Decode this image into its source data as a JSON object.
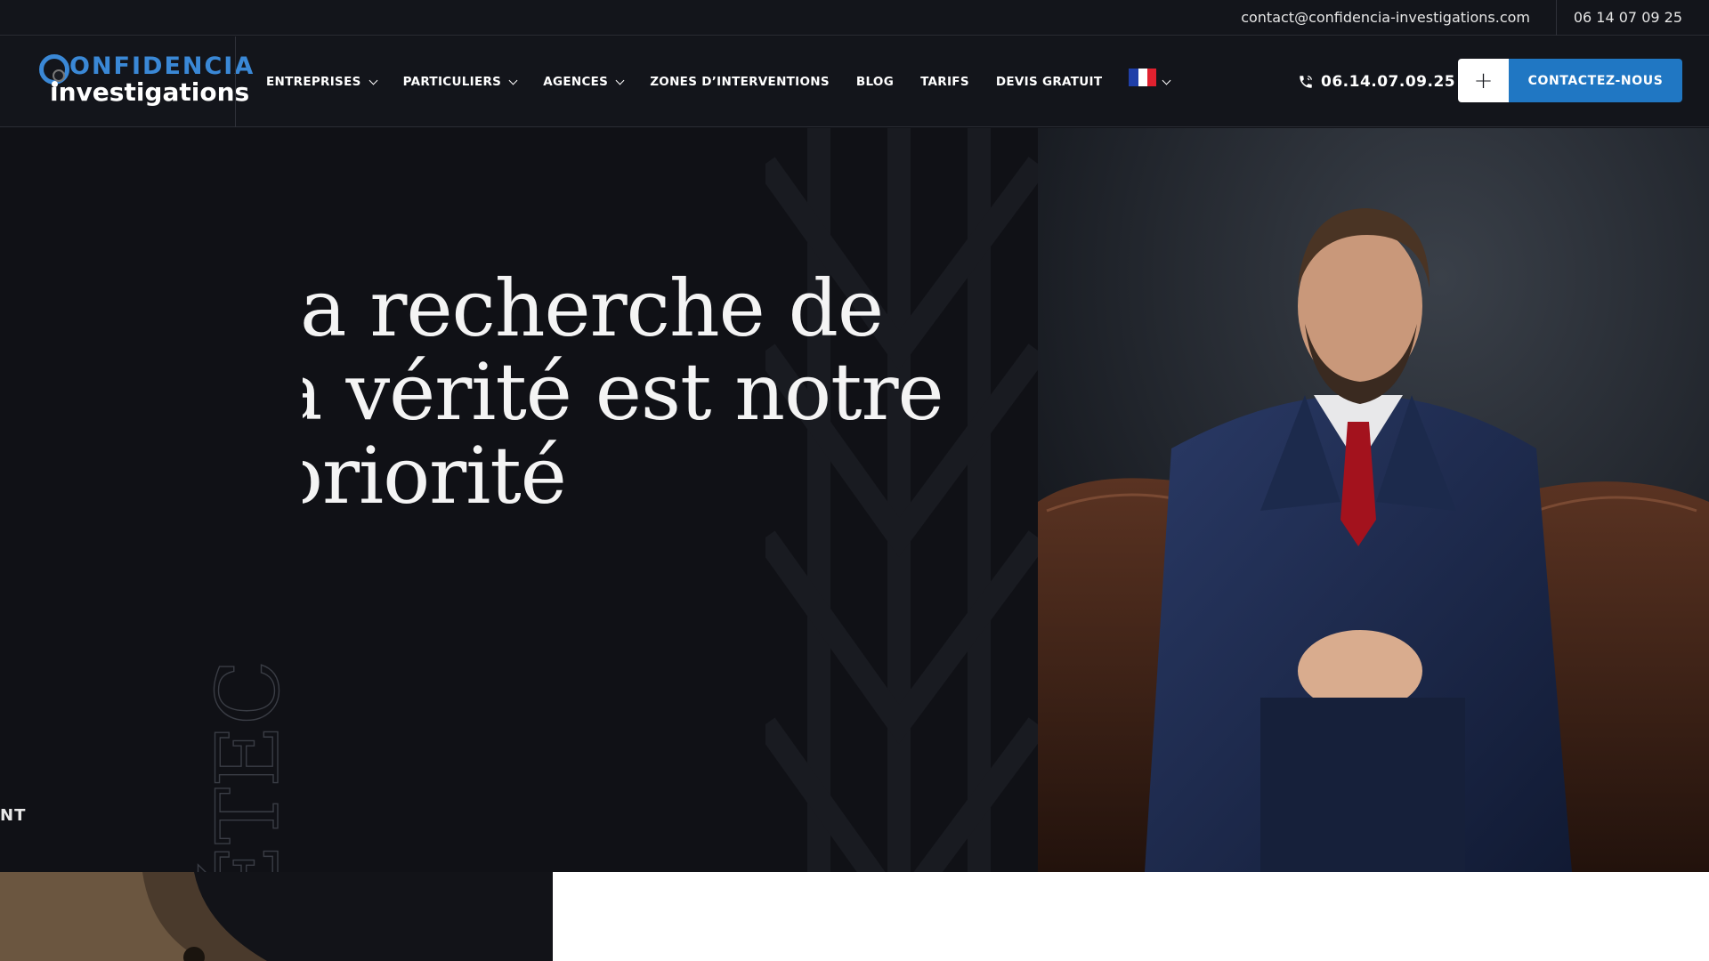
{
  "topbar": {
    "email": "contact@confidencia-investigations.com",
    "phone": "06 14 07 09 25"
  },
  "logo": {
    "line1": "ONFIDENCIA",
    "line2": "nvestigations",
    "alt": "Confidencia Investigations"
  },
  "nav": {
    "items": [
      {
        "label": "ENTREPRISES",
        "has_dropdown": true
      },
      {
        "label": "PARTICULIERS",
        "has_dropdown": true
      },
      {
        "label": "AGENCES",
        "has_dropdown": true
      },
      {
        "label": "ZONES D’INTERVENTIONS",
        "has_dropdown": false
      },
      {
        "label": "BLOG",
        "has_dropdown": false
      },
      {
        "label": "TARIFS",
        "has_dropdown": false
      },
      {
        "label": "DEVIS GRATUIT",
        "has_dropdown": false
      }
    ],
    "language_flag": "fr-flag-icon"
  },
  "header": {
    "phone": "06.14.07.09.25",
    "plus_label": "+",
    "cta_label": "CONTACTEZ-NOUS"
  },
  "hero": {
    "title_lines": [
      ".a recherche de",
      "a vérité est notre",
      "oriorité"
    ],
    "vertical_word": "DÉTEC",
    "side_text": "NT"
  },
  "colors": {
    "accent": "#2077c3",
    "background": "#111218",
    "header_bg": "#13151b",
    "text": "#ffffff"
  }
}
